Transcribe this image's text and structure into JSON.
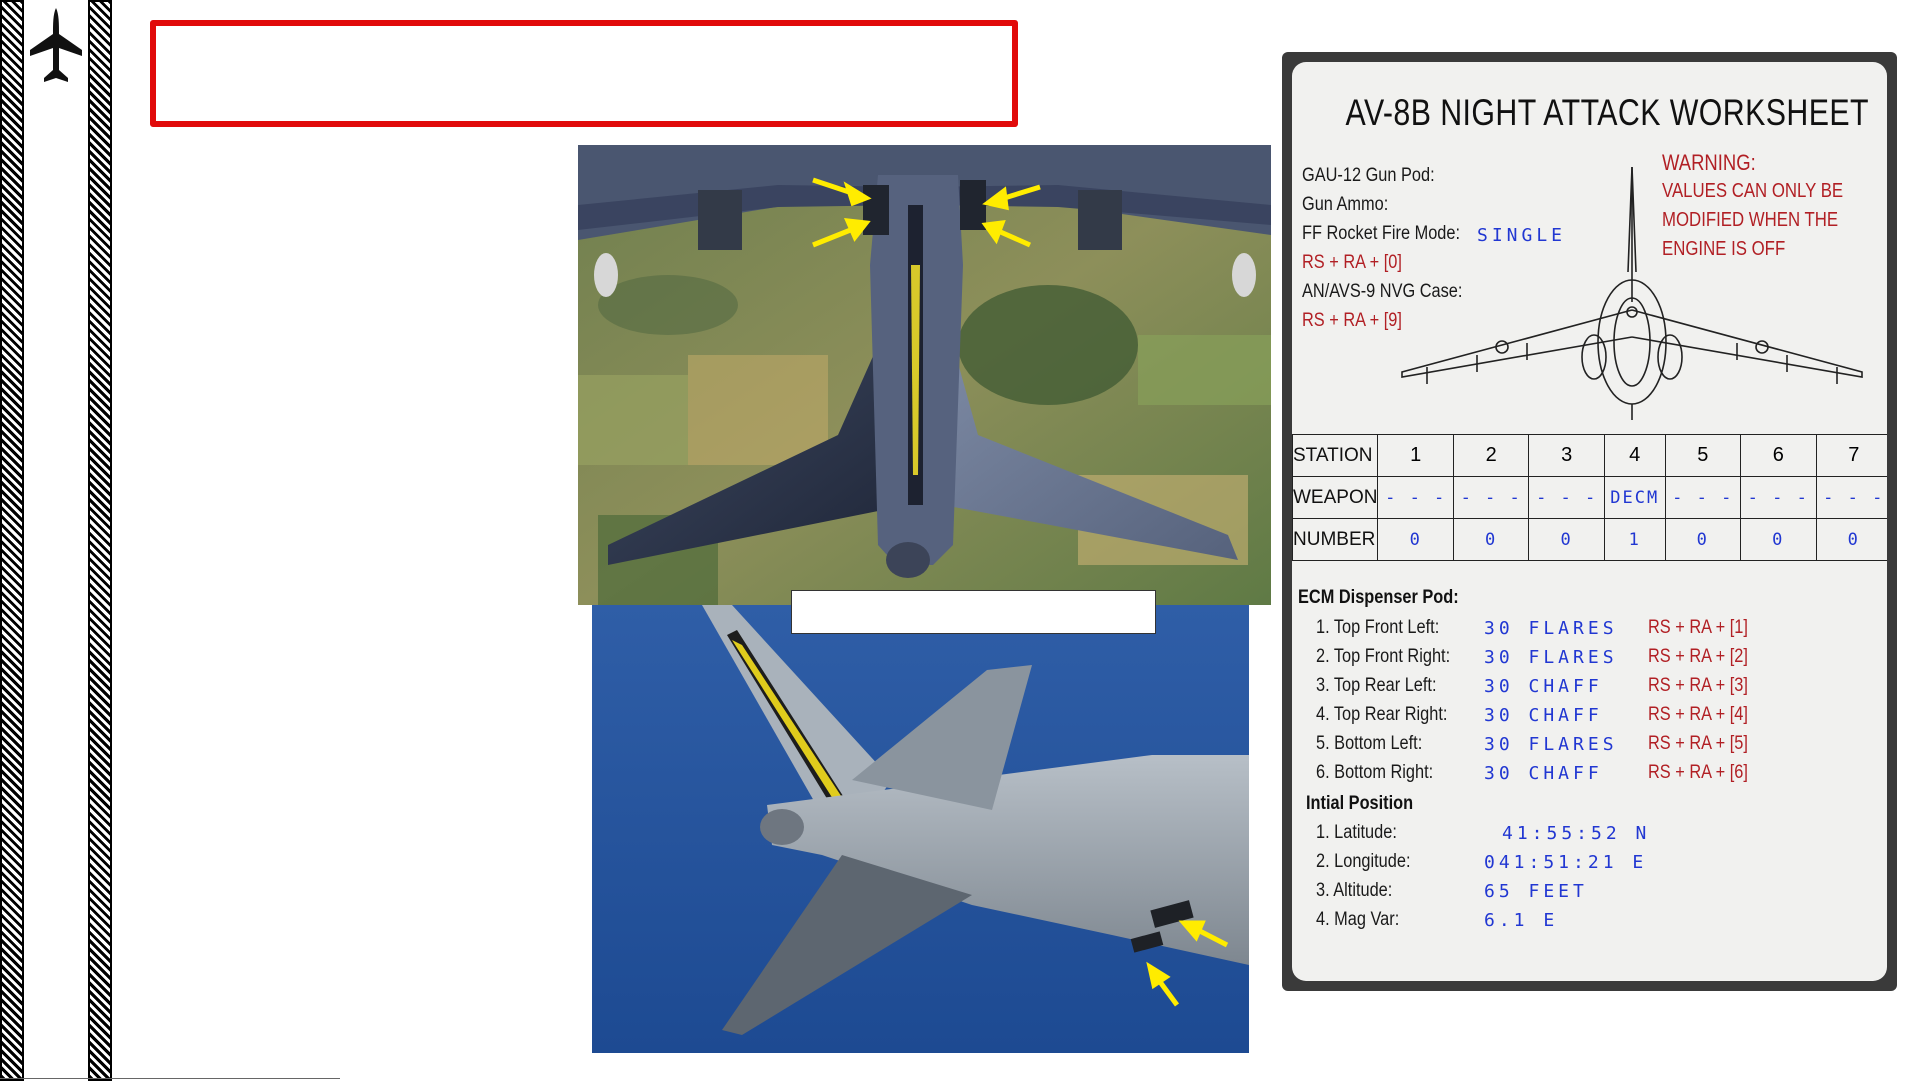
{
  "sidebar": {
    "logo_icon": "fighter-jet-icon"
  },
  "worksheet": {
    "title": "AV-8B NIGHT ATTACK WORKSHEET",
    "settings": [
      {
        "label": "GAU-12 Gun Pod:",
        "value": ""
      },
      {
        "label": "Gun Ammo:",
        "value": ""
      },
      {
        "label": "FF Rocket Fire Mode:",
        "value": "SINGLE"
      },
      {
        "label": "RS + RA + [0]",
        "value": ""
      },
      {
        "label": "AN/AVS-9 NVG Case:",
        "value": ""
      },
      {
        "label": "RS + RA + [9]",
        "value": ""
      }
    ],
    "warning": [
      "WARNING:",
      "VALUES CAN ONLY BE",
      "MODIFIED WHEN THE",
      "ENGINE IS OFF"
    ],
    "table": {
      "station_label": "STATION",
      "weapon_label": "WEAPON",
      "number_label": "NUMBER",
      "stations": [
        "1",
        "2",
        "3",
        "4",
        "5",
        "6",
        "7"
      ],
      "weapons": [
        "- - -",
        "- - -",
        "- - -",
        "DECM",
        "- - -",
        "- - -",
        "- - -"
      ],
      "numbers": [
        "0",
        "0",
        "0",
        "1",
        "0",
        "0",
        "0"
      ]
    },
    "ecm": {
      "title": "ECM Dispenser Pod:",
      "items": [
        {
          "label": "1. Top Front Left:",
          "value": "30 FLARES",
          "keys": "RS + RA + [1]"
        },
        {
          "label": "2. Top Front Right:",
          "value": "30 FLARES",
          "keys": "RS + RA + [2]"
        },
        {
          "label": "3. Top Rear Left:",
          "value": "30 CHAFF",
          "keys": "RS + RA + [3]"
        },
        {
          "label": "4. Top Rear Right:",
          "value": "30 CHAFF",
          "keys": "RS + RA + [4]"
        },
        {
          "label": "5. Bottom Left:",
          "value": "30 FLARES",
          "keys": "RS + RA + [5]"
        },
        {
          "label": "6. Bottom Right:",
          "value": "30 CHAFF",
          "keys": "RS + RA + [6]"
        }
      ]
    },
    "position": {
      "title": "Intial Position",
      "items": [
        {
          "label": "1. Latitude:",
          "value": "41:55:52 N"
        },
        {
          "label": "2. Longitude:",
          "value": "041:51:21 E"
        },
        {
          "label": "3. Altitude:",
          "value": "65 FEET"
        },
        {
          "label": "4. Mag Var:",
          "value": "6.1 E"
        }
      ]
    }
  },
  "colors": {
    "title_box_border": "#e10b0b",
    "worksheet_blue": "#2137d2",
    "worksheet_red": "#b11f24",
    "arrow": "#ffec00"
  }
}
